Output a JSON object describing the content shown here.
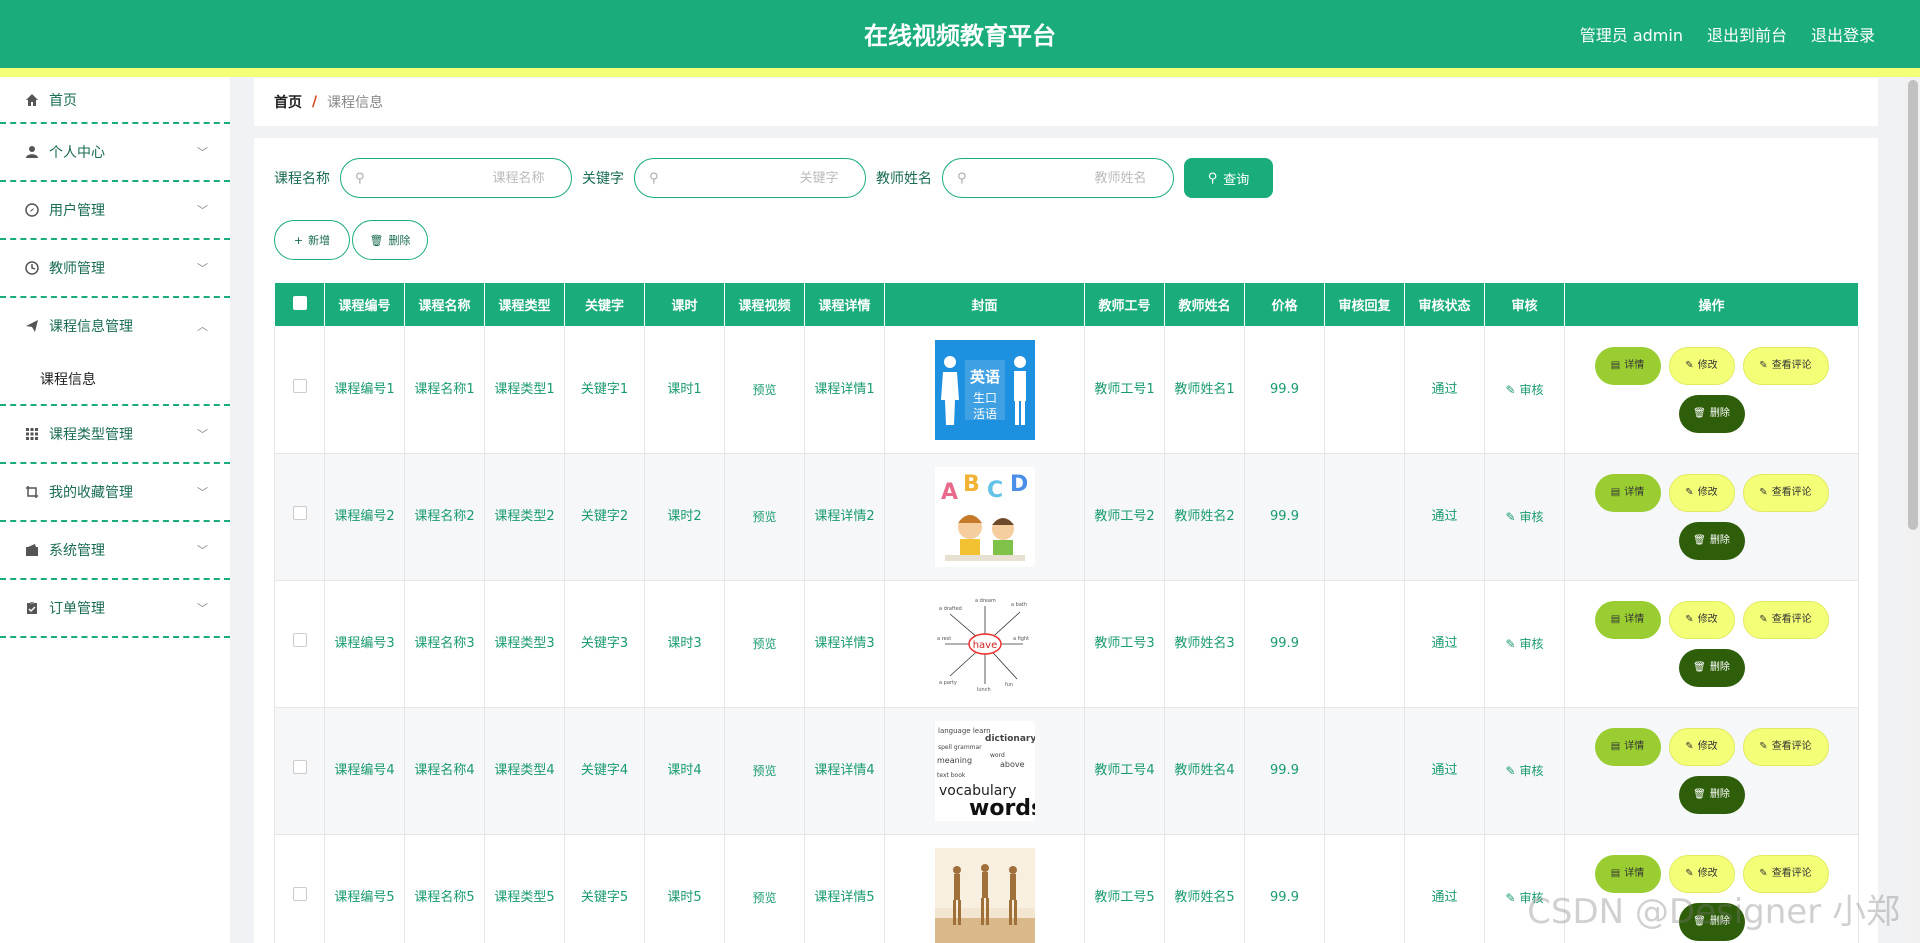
{
  "header": {
    "title": "在线视频教育平台",
    "links": [
      "管理员 admin",
      "退出到前台",
      "退出登录"
    ]
  },
  "sidebar": {
    "items": [
      {
        "label": "首页",
        "icon": "home-icon"
      },
      {
        "label": "个人中心",
        "icon": "user-icon"
      },
      {
        "label": "用户管理",
        "icon": "compass-icon"
      },
      {
        "label": "教师管理",
        "icon": "clock-icon"
      },
      {
        "label": "课程信息管理",
        "icon": "send-icon",
        "submenu": [
          "课程信息"
        ]
      },
      {
        "label": "课程类型管理",
        "icon": "grid-icon"
      },
      {
        "label": "我的收藏管理",
        "icon": "crop-icon"
      },
      {
        "label": "系统管理",
        "icon": "wallet-icon"
      },
      {
        "label": "订单管理",
        "icon": "clipboard-icon"
      }
    ]
  },
  "breadcrumb": {
    "home": "首页",
    "separator": "/",
    "current": "课程信息"
  },
  "search": {
    "fields": [
      {
        "label": "课程名称",
        "placeholder": "课程名称"
      },
      {
        "label": "关键字",
        "placeholder": "关键字"
      },
      {
        "label": "教师姓名",
        "placeholder": "教师姓名"
      }
    ],
    "query_label": "查询"
  },
  "actions": {
    "add_label": "新增",
    "delete_label": "删除"
  },
  "table": {
    "columns": [
      "课程编号",
      "课程名称",
      "课程类型",
      "关键字",
      "课时",
      "课程视频",
      "课程详情",
      "封面",
      "教师工号",
      "教师姓名",
      "价格",
      "审核回复",
      "审核状态",
      "审核",
      "操作"
    ],
    "op_labels": {
      "detail": "详情",
      "edit": "修改",
      "comment": "查看评论",
      "delete": "删除"
    },
    "audit_label": "审核",
    "rows": [
      {
        "no": "课程编号1",
        "name": "课程名称1",
        "type": "课程类型1",
        "keyword": "关键字1",
        "hours": "课时1",
        "video": "预览",
        "detail": "课程详情1",
        "cover": "english-cover",
        "tno": "教师工号1",
        "tname": "教师姓名1",
        "price": "99.9",
        "reply": "",
        "status": "通过"
      },
      {
        "no": "课程编号2",
        "name": "课程名称2",
        "type": "课程类型2",
        "keyword": "关键字2",
        "hours": "课时2",
        "video": "预览",
        "detail": "课程详情2",
        "cover": "abcd-cover",
        "tno": "教师工号2",
        "tname": "教师姓名2",
        "price": "99.9",
        "reply": "",
        "status": "通过"
      },
      {
        "no": "课程编号3",
        "name": "课程名称3",
        "type": "课程类型3",
        "keyword": "关键字3",
        "hours": "课时3",
        "video": "预览",
        "detail": "课程详情3",
        "cover": "have-mindmap-cover",
        "tno": "教师工号3",
        "tname": "教师姓名3",
        "price": "99.9",
        "reply": "",
        "status": "通过"
      },
      {
        "no": "课程编号4",
        "name": "课程名称4",
        "type": "课程类型4",
        "keyword": "关键字4",
        "hours": "课时4",
        "video": "预览",
        "detail": "课程详情4",
        "cover": "vocabulary-words-cover",
        "tno": "教师工号4",
        "tname": "教师姓名4",
        "price": "99.9",
        "reply": "",
        "status": "通过"
      },
      {
        "no": "课程编号5",
        "name": "课程名称5",
        "type": "课程类型5",
        "keyword": "关键字5",
        "hours": "课时5",
        "video": "预览",
        "detail": "课程详情5",
        "cover": "dancers-cover",
        "tno": "教师工号5",
        "tname": "教师姓名5",
        "price": "99.9",
        "reply": "",
        "status": "通过"
      }
    ]
  },
  "watermark": "CSDN @Designer 小郑",
  "colors": {
    "primary": "#1aac7a",
    "stripe": "#f4ff78",
    "detail": "#9acd32",
    "delete": "#2e5e0a"
  }
}
